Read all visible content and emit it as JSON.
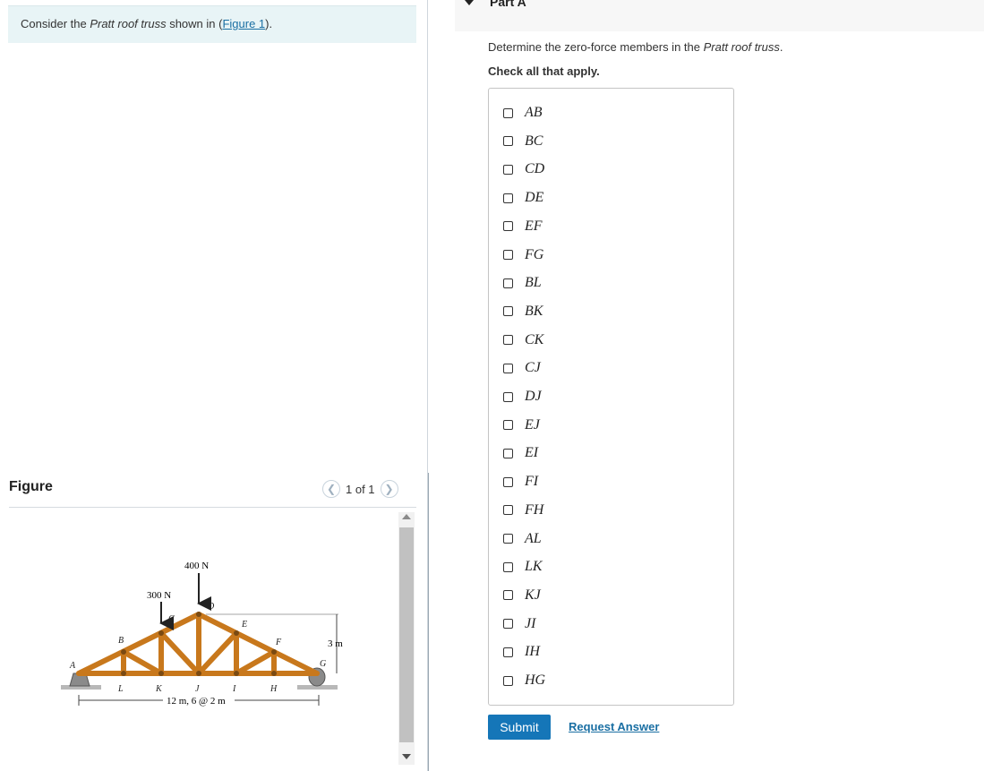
{
  "intro": {
    "prefix": "Consider the ",
    "italic": "Pratt roof truss",
    "middle": " shown in (",
    "link": "Figure 1",
    "suffix": ")."
  },
  "figure": {
    "title": "Figure",
    "pager_text": "1 of 1",
    "truss": {
      "loads": [
        "400 N",
        "300 N"
      ],
      "top_joints": [
        "A",
        "B",
        "C",
        "D",
        "E",
        "F",
        "G"
      ],
      "bottom_joints": [
        "L",
        "K",
        "J",
        "I",
        "H"
      ],
      "height_label": "3 m",
      "span_label": "12 m, 6 @ 2 m"
    }
  },
  "part": {
    "label": "Part A",
    "question_prefix": "Determine the zero-force members in the ",
    "question_italic": "Pratt roof truss",
    "question_suffix": ".",
    "instruction": "Check all that apply.",
    "options": [
      "AB",
      "BC",
      "CD",
      "DE",
      "EF",
      "FG",
      "BL",
      "BK",
      "CK",
      "CJ",
      "DJ",
      "EJ",
      "EI",
      "FI",
      "FH",
      "AL",
      "LK",
      "KJ",
      "JI",
      "IH",
      "HG"
    ],
    "submit_label": "Submit",
    "request_label": "Request Answer"
  },
  "colors": {
    "accent": "#1576b8",
    "link": "#1a6fa3",
    "intro_bg": "#e8f4f6",
    "truss_wood": "#c8781c"
  }
}
